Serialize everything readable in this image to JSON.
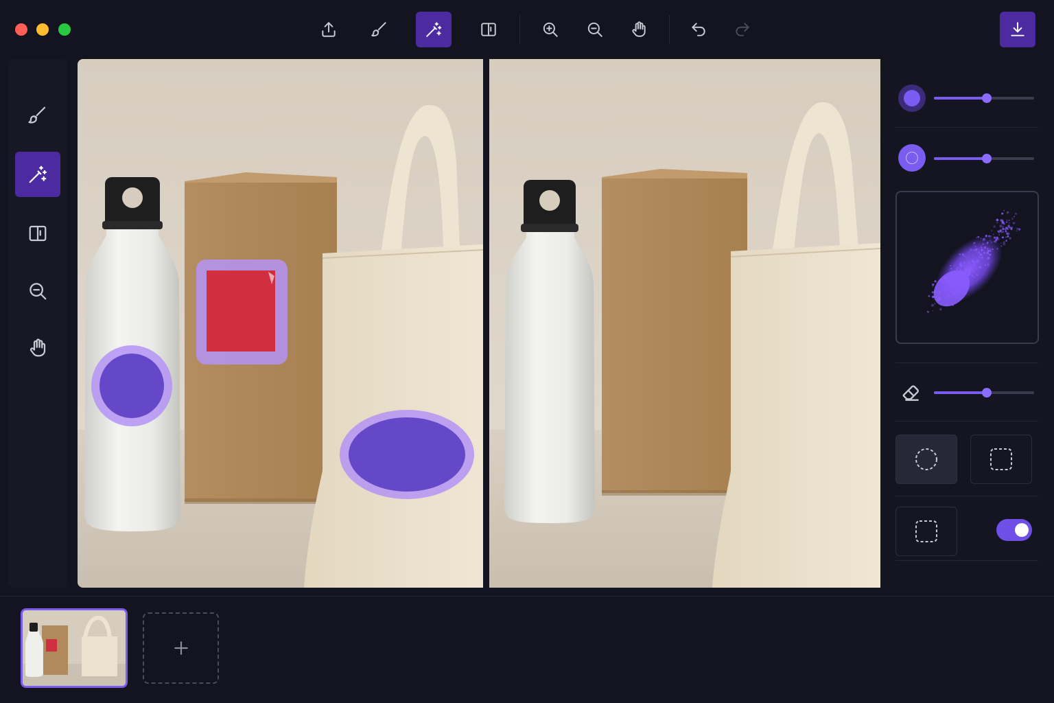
{
  "window": {
    "controls": [
      "close",
      "minimize",
      "maximize"
    ]
  },
  "toolbar": {
    "tools": [
      {
        "id": "export",
        "icon": "upload-icon"
      },
      {
        "id": "brush",
        "icon": "brush-icon"
      },
      {
        "id": "magic-wand",
        "icon": "magic-wand-icon",
        "active": true
      },
      {
        "id": "compare",
        "icon": "split-view-icon"
      },
      {
        "id": "zoom-in",
        "icon": "zoom-in-icon"
      },
      {
        "id": "zoom-out",
        "icon": "zoom-out-icon"
      },
      {
        "id": "pan",
        "icon": "hand-icon"
      },
      {
        "id": "undo",
        "icon": "undo-icon"
      },
      {
        "id": "redo",
        "icon": "redo-icon",
        "disabled": true
      }
    ],
    "download": {
      "icon": "download-icon"
    }
  },
  "sidebar": {
    "tools": [
      {
        "id": "brush",
        "icon": "brush-icon"
      },
      {
        "id": "magic-wand",
        "icon": "magic-wand-icon",
        "active": true
      },
      {
        "id": "compare",
        "icon": "split-view-icon"
      },
      {
        "id": "zoom",
        "icon": "zoom-out-icon"
      },
      {
        "id": "pan",
        "icon": "hand-icon"
      }
    ]
  },
  "panel": {
    "brush_size": {
      "value": 0.53
    },
    "brush_softness": {
      "value": 0.53
    },
    "eraser_strength": {
      "value": 0.53
    },
    "selection_shapes": [
      {
        "id": "ellipse",
        "icon": "dashed-circle-icon",
        "selected": true
      },
      {
        "id": "rectangle",
        "icon": "dashed-square-icon",
        "selected": false
      },
      {
        "id": "rectangle-2",
        "icon": "dashed-square-icon",
        "selected": false
      }
    ],
    "toggle_on": true
  },
  "colors": {
    "accent": "#7a5cf0",
    "active_bg": "#4c2ba0",
    "mask_fill": "#6448c8",
    "mask_ring": "#b493f5",
    "background": "#131420"
  },
  "filmstrip": {
    "items": [
      {
        "selected": true
      }
    ],
    "add_icon": "plus-icon"
  }
}
